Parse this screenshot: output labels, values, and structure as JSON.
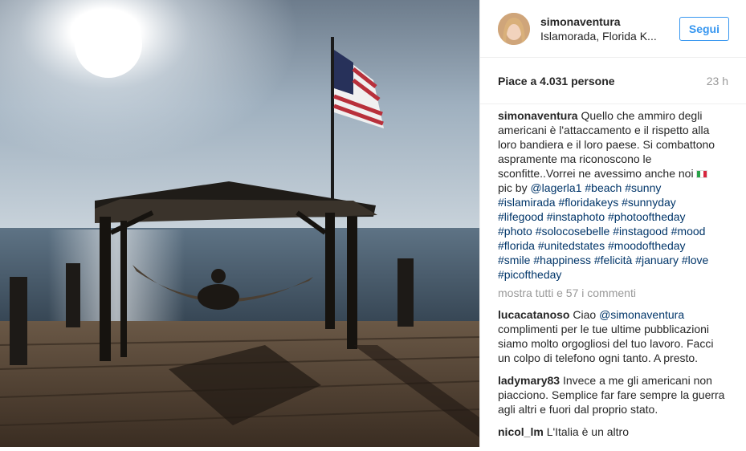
{
  "post": {
    "username": "simonaventura",
    "location": "Islamorada, Florida K...",
    "follow_label": "Segui",
    "likes": "Piace a 4.031 persone",
    "time": "23 h",
    "caption": {
      "user": "simonaventura",
      "text": "Quello che ammiro degli americani è l'attaccamento e il rispetto alla loro bandiera e il loro paese. Si combattono aspramente ma riconoscono le sconfitte..Vorrei ne avessimo anche noi",
      "flag_icon": "italy-flag-icon",
      "pic_by": "pic by",
      "mention": "@lagerla1",
      "hashtags": [
        "#beach",
        "#sunny",
        "#islamirada",
        "#floridakeys",
        "#sunnyday",
        "#lifegood",
        "#instaphoto",
        "#photooftheday",
        "#photo",
        "#solocosebelle",
        "#instagood",
        "#mood",
        "#florida",
        "#unitedstates",
        "#moodoftheday",
        "#smile",
        "#happiness",
        "#felicità",
        "#january",
        "#love",
        "#picoftheday"
      ]
    },
    "show_all": "mostra tutti e 57 i commenti",
    "comments": [
      {
        "user": "lucacatanoso",
        "pre": "Ciao",
        "mention": "@simonaventura",
        "text": "complimenti per le tue ultime pubblicazioni siamo molto orgogliosi del tuo lavoro. Facci un colpo di telefono ogni tanto. A presto."
      },
      {
        "user": "ladymary83",
        "text": "Invece a me gli americani non piacciono. Semplice far fare sempre la guerra agli altri e fuori dal proprio stato."
      },
      {
        "user": "nicol_lm",
        "text": "L'Italia è un altro"
      }
    ]
  },
  "colors": {
    "accent": "#3897f0",
    "link": "#003569",
    "muted": "#999999"
  }
}
